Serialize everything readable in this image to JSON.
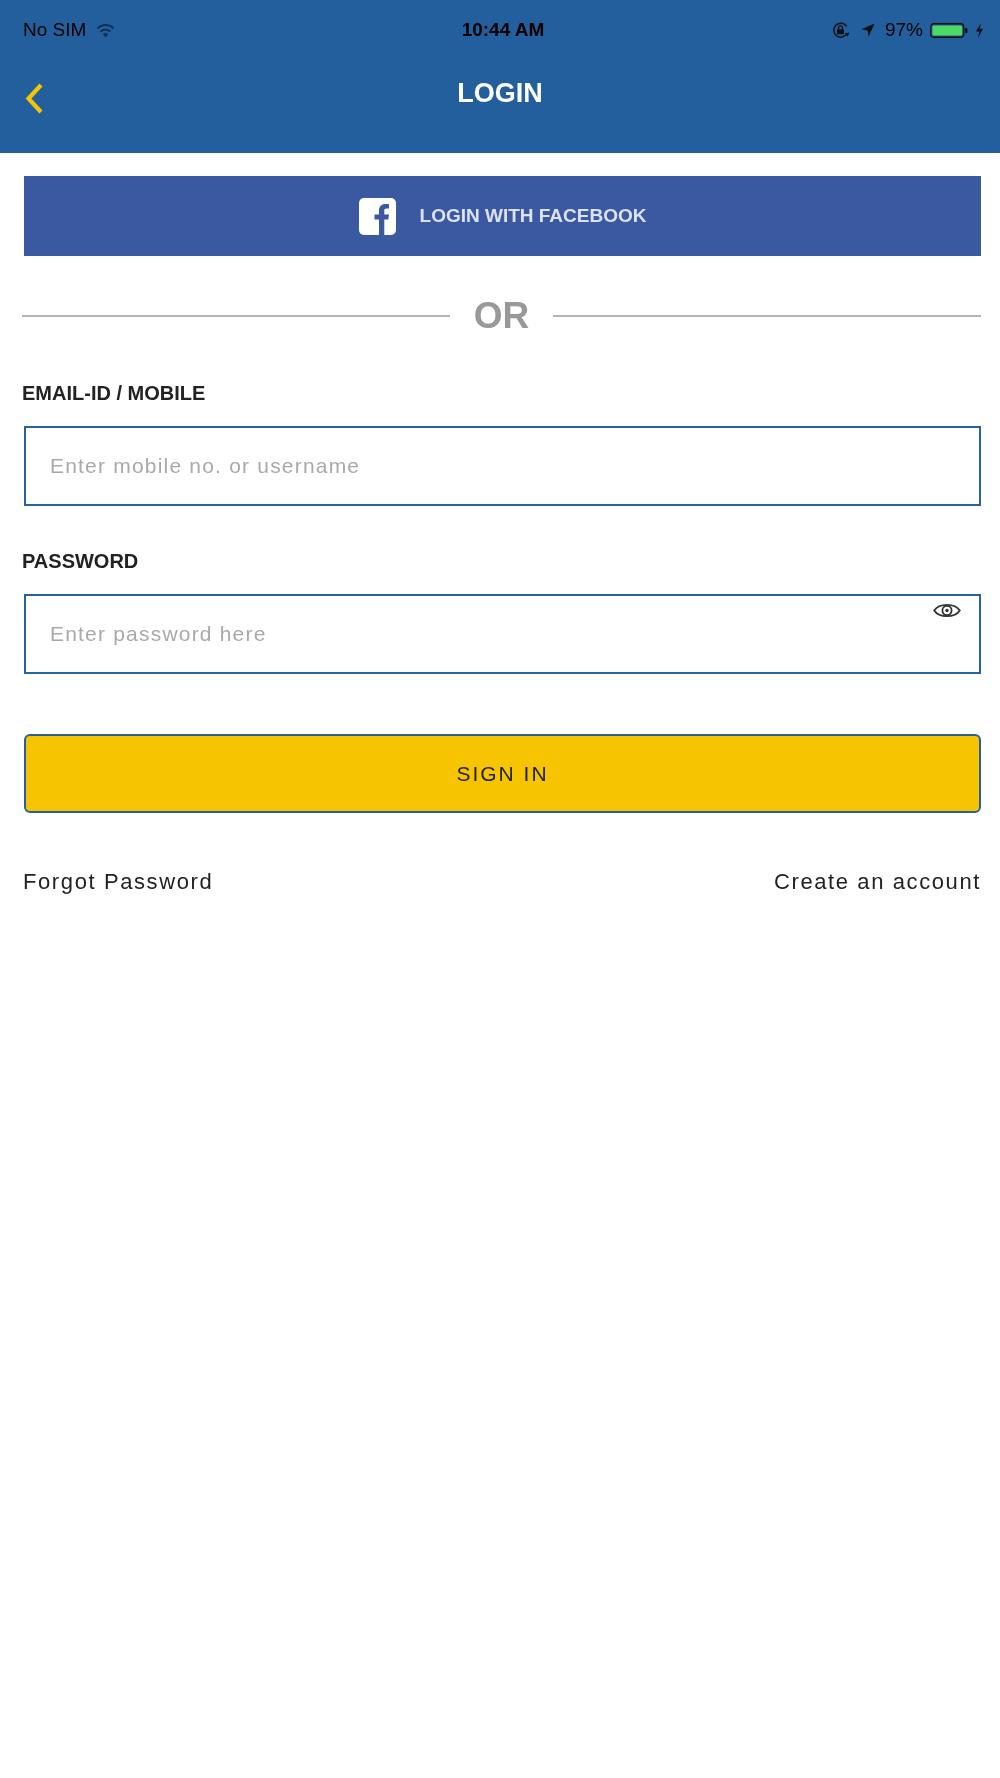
{
  "status_bar": {
    "carrier": "No SIM",
    "time": "10:44 AM",
    "battery_percent": "97%"
  },
  "header": {
    "title": "LOGIN"
  },
  "facebook_button": {
    "label": "LOGIN WITH FACEBOOK"
  },
  "divider": {
    "label": "OR"
  },
  "fields": [
    {
      "kind": "text",
      "label": "EMAIL-ID / MOBILE",
      "placeholder": "Enter mobile no. or username"
    },
    {
      "kind": "password",
      "label": "PASSWORD",
      "placeholder": "Enter password here"
    }
  ],
  "sign_in_button": {
    "label": "SIGN IN"
  },
  "links": [
    {
      "label": "Forgot Password"
    },
    {
      "label": "Create an account"
    }
  ]
}
